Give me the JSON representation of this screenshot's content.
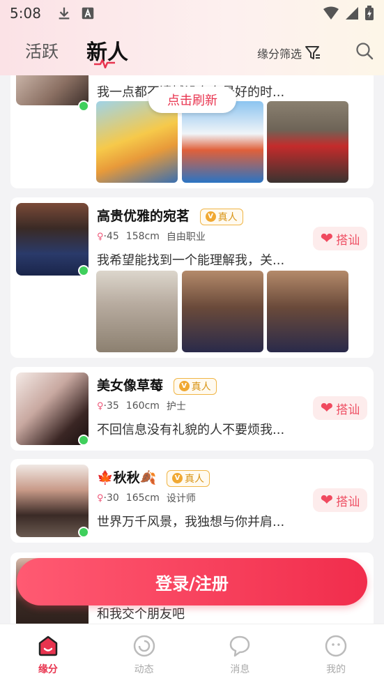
{
  "status": {
    "time": "5:08"
  },
  "header": {
    "tabs": [
      {
        "label": "活跃"
      },
      {
        "label": "新人"
      }
    ],
    "filter_label": "缘分筛选"
  },
  "refresh_label": "点击刷新",
  "users": [
    {
      "name": "",
      "bio": "我一点都不遗憾没有在最好的时...",
      "badge": "",
      "age": "",
      "height": "",
      "job": ""
    },
    {
      "name": "高贵优雅的宛茗",
      "badge": "真人",
      "age": "·45",
      "height": "158cm",
      "job": "自由职业",
      "bio": "我希望能找到一个能理解我，关...",
      "chat_label": "搭讪"
    },
    {
      "name": "美女像草莓",
      "badge": "真人",
      "age": "·35",
      "height": "160cm",
      "job": "护士",
      "bio": "不回信息没有礼貌的人不要烦我...",
      "chat_label": "搭讪"
    },
    {
      "name": "🍁秋秋🍂",
      "badge": "真人",
      "age": "·30",
      "height": "165cm",
      "job": "设计师",
      "bio": "世界万千风景，我独想与你并肩...",
      "chat_label": "搭讪"
    },
    {
      "bio": "和我交个朋友吧"
    }
  ],
  "login_label": "登录/注册",
  "nav": [
    {
      "label": "缘分"
    },
    {
      "label": "动态"
    },
    {
      "label": "消息"
    },
    {
      "label": "我的"
    }
  ],
  "colors": {
    "accent": "#e8344f",
    "online": "#3fcf5c",
    "badge": "#f0a832"
  }
}
